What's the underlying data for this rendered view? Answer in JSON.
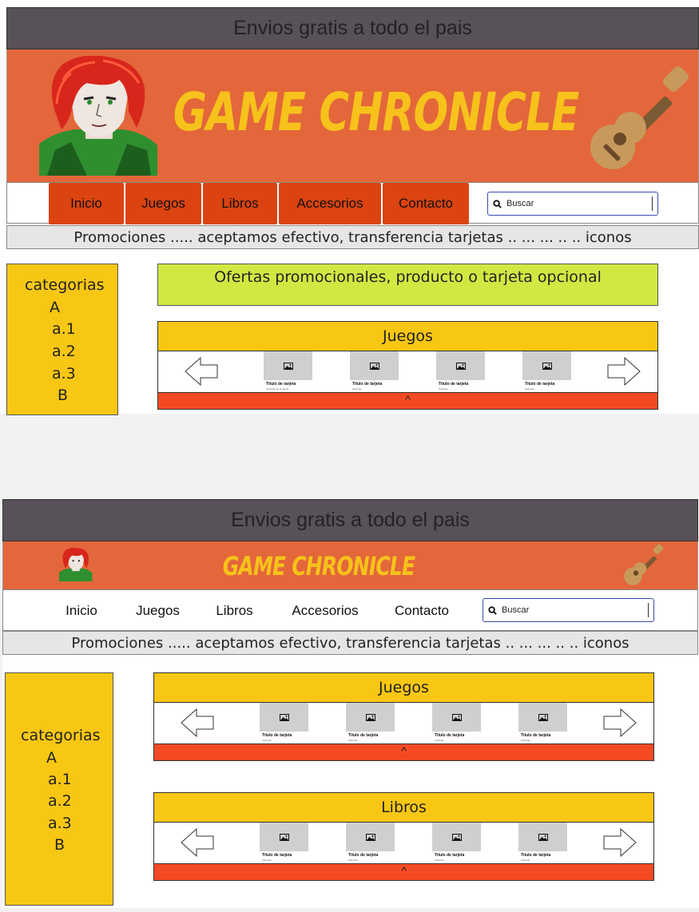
{
  "mockups": [
    {
      "topbar": "Envios gratis a todo el pais",
      "logo": "GAME CHRONICLE",
      "nav": [
        "Inicio",
        "Juegos",
        "Libros",
        "Accesorios",
        "Contacto"
      ],
      "search_placeholder": "Buscar",
      "promo": "Promociones ..... aceptamos efectivo, transferencia tarjetas .. ... ... .. .. iconos",
      "categories": [
        "categorias",
        "A",
        "a.1",
        "a.2",
        "a.3",
        "B"
      ],
      "offers": "Ofertas promocionales, producto o tarjeta opcional",
      "carousels": [
        {
          "title": "Juegos",
          "footer": "^",
          "cards": [
            {
              "title": "Título de tarjeta",
              "subtitle": "Subtítulo de la tarjeta"
            },
            {
              "title": "Título de tarjeta",
              "subtitle": "Subtítulo"
            },
            {
              "title": "Título de tarjeta",
              "subtitle": "Subtítulo"
            },
            {
              "title": "Título de tarjeta",
              "subtitle": "Subtítulo"
            }
          ]
        }
      ]
    },
    {
      "topbar": "Envios gratis a todo el pais",
      "logo": "GAME CHRONICLE",
      "nav": [
        "Inicio",
        "Juegos",
        "Libros",
        "Accesorios",
        "Contacto"
      ],
      "search_placeholder": "Buscar",
      "promo": "Promociones ..... aceptamos efectivo, transferencia tarjetas .. ... ... .. .. iconos",
      "categories": [
        "categorias",
        "A",
        "a.1",
        "a.2",
        "a.3",
        "B"
      ],
      "carousels": [
        {
          "title": "Juegos",
          "footer": "^",
          "cards": [
            {
              "title": "Título de tarjeta",
              "subtitle": "Subtítulo"
            },
            {
              "title": "Título de tarjeta",
              "subtitle": "Subtítulo"
            },
            {
              "title": "Título de tarjeta",
              "subtitle": "Subtítulo"
            },
            {
              "title": "Título de tarjeta",
              "subtitle": "Subtítulo"
            }
          ]
        },
        {
          "title": "Libros",
          "footer": "^",
          "cards": [
            {
              "title": "Título de tarjeta",
              "subtitle": "Subtítulo"
            },
            {
              "title": "Título de tarjeta",
              "subtitle": "Subtítulo"
            },
            {
              "title": "Título de tarjeta",
              "subtitle": "Subtítulo"
            },
            {
              "title": "Título de tarjeta",
              "subtitle": "Subtítulo"
            }
          ]
        }
      ]
    }
  ],
  "colors": {
    "topbar": "#595159",
    "header": "#e3673a",
    "logo": "#f6c21b",
    "nav_button": "#db4310",
    "categories": "#f8c714",
    "offers": "#d1e843",
    "carousel_footer": "#f44a24"
  },
  "icons": [
    "avatar-illustration",
    "guitar-icon",
    "search-icon",
    "arrow-left-icon",
    "arrow-right-icon",
    "image-placeholder-icon"
  ]
}
